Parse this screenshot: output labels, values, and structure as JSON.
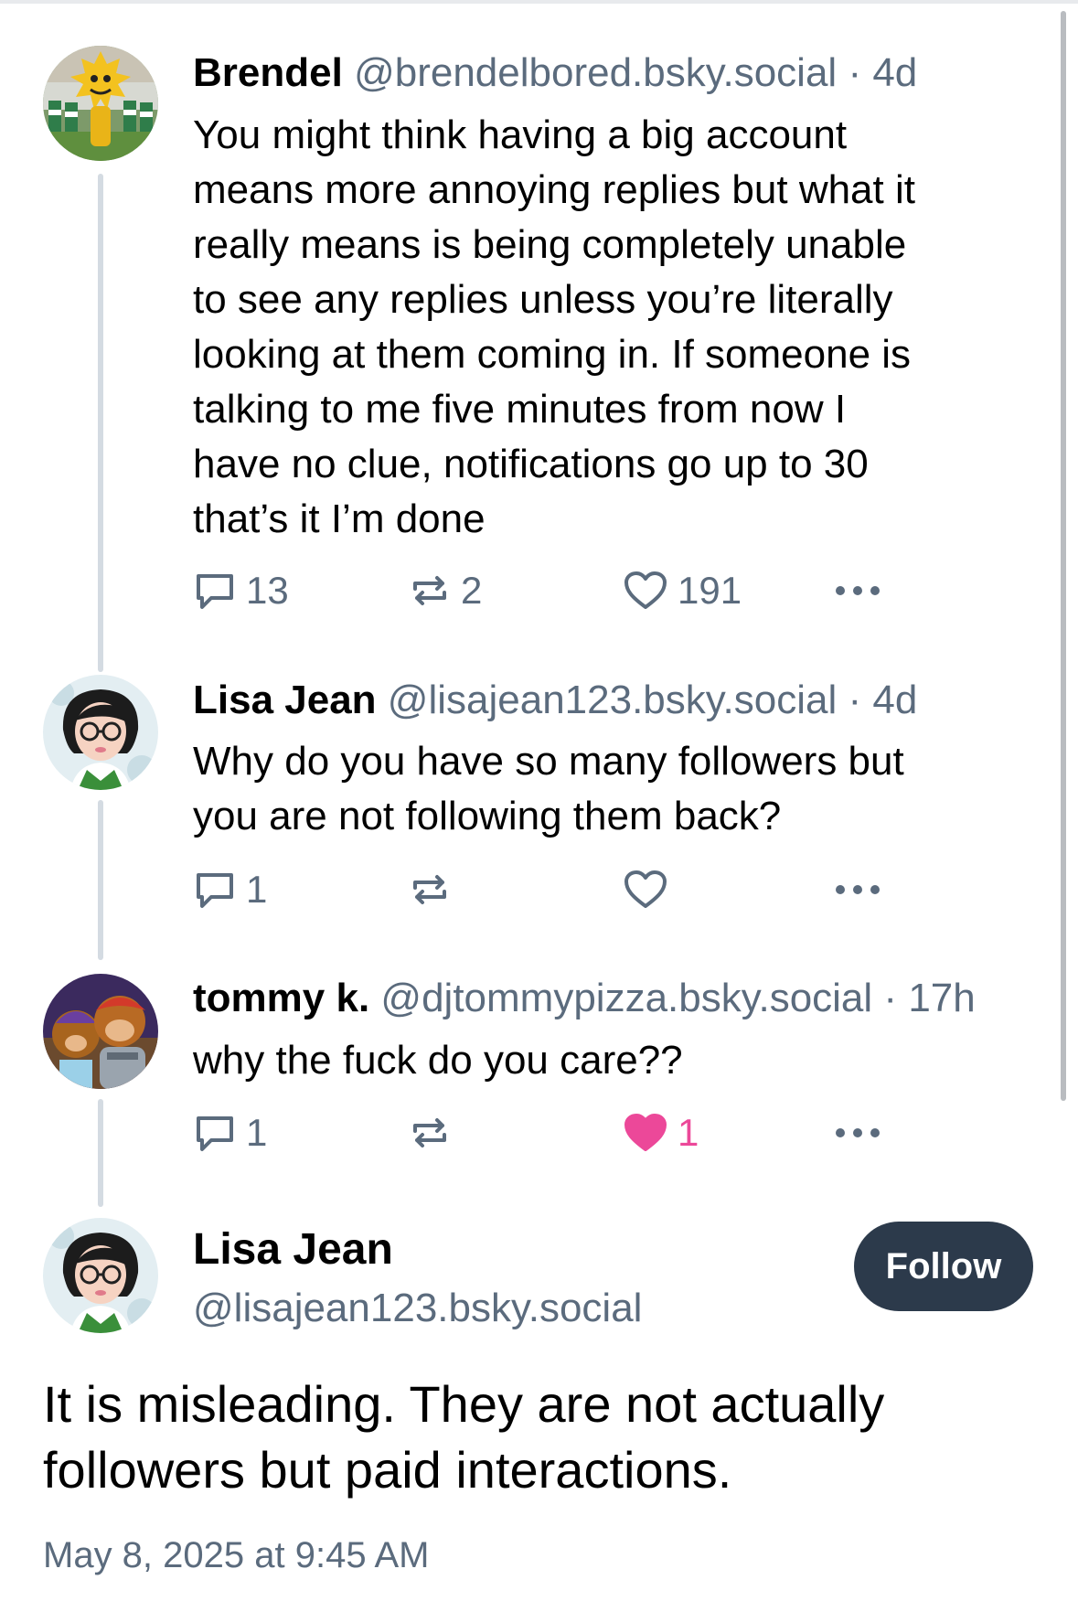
{
  "posts": [
    {
      "name": "Brendel",
      "handle": "@brendelbored.bsky.social",
      "separator": "·",
      "time": "4d",
      "lines": [
        "You might think having a big account",
        "means more annoying replies but what it",
        "really means is being completely unable",
        "to see any replies unless you’re literally",
        "looking at them coming in. If someone is",
        "talking to me five minutes from now I",
        "have no clue, notifications go up to 30",
        "that’s it I’m done"
      ],
      "replies": "13",
      "reposts": "2",
      "likes": "191",
      "liked": false
    },
    {
      "name": "Lisa Jean",
      "handle": "@lisajean123.bsky.social",
      "separator": "·",
      "time": "4d",
      "lines": [
        "Why do you have so many followers but",
        "you are not following them back?"
      ],
      "replies": "1",
      "reposts": "",
      "likes": "",
      "liked": false
    },
    {
      "name": "tommy k.",
      "handle": "@djtommypizza.bsky.social",
      "separator": "·",
      "time": "17h",
      "lines": [
        "why the fuck do you care??"
      ],
      "replies": "1",
      "reposts": "",
      "likes": "1",
      "liked": true
    }
  ],
  "focused": {
    "name": "Lisa Jean",
    "handle": "@lisajean123.bsky.social",
    "follow_label": "Follow",
    "lines": [
      "It is misleading. They are not actually",
      "followers but paid interactions."
    ],
    "timestamp": "May 8, 2025 at 9:45 AM"
  },
  "icons": {
    "reply": "speech-bubble-icon",
    "repost": "repost-arrows-icon",
    "like": "heart-icon",
    "more": "ellipsis-icon"
  },
  "colors": {
    "muted": "#5b6b7d",
    "like_active": "#ec4899",
    "follow_bg": "#2c3a4b",
    "thread_line": "#d4dbe2"
  }
}
